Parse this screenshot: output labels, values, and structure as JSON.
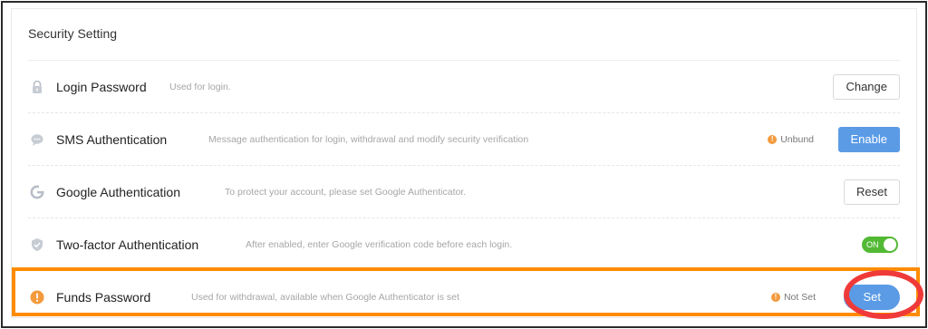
{
  "panel": {
    "title": "Security Setting"
  },
  "rows": [
    {
      "name": "Login Password",
      "desc": "Used for login.",
      "status": "",
      "action": "Change"
    },
    {
      "name": "SMS Authentication",
      "desc": "Message authentication for login, withdrawal and modify security verification",
      "status": "Unbund",
      "action": "Enable"
    },
    {
      "name": "Google Authentication",
      "desc": "To protect your account, please set Google Authenticator.",
      "status": "",
      "action": "Reset"
    },
    {
      "name": "Two-factor Authentication",
      "desc": "After enabled, enter Google verification code before each login.",
      "status": "",
      "toggle": "ON"
    },
    {
      "name": "Funds Password",
      "desc": "Used for withdrawal, available when Google Authenticator is set",
      "status": "Not Set",
      "action": "Set"
    }
  ],
  "colors": {
    "primary": "#5b9be6",
    "warning": "#f39a3d",
    "toggle_on": "#52b934",
    "highlight_orange": "#ff8c00",
    "highlight_red": "#f03a3a"
  },
  "icons": {
    "login": "lock-icon",
    "sms": "chat-bubble-icon",
    "google": "google-icon",
    "twofactor": "shield-check-icon",
    "funds": "alert-circle-icon",
    "status_warning": "warning-dot-icon"
  }
}
